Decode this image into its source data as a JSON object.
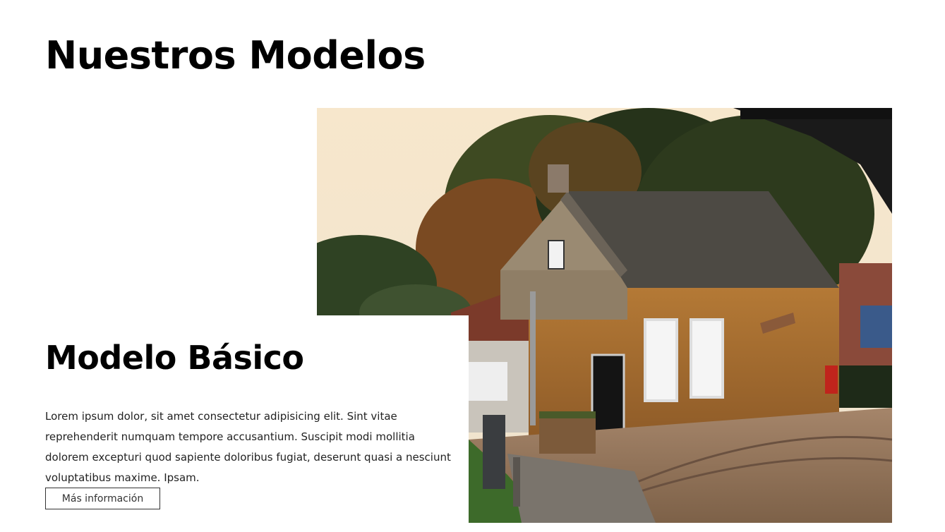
{
  "section": {
    "title": "Nuestros Modelos"
  },
  "model": {
    "name": "Modelo Básico",
    "description": "Lorem ipsum dolor, sit amet consectetur adipisicing elit. Sint vitae reprehenderit numquam tempore accusantium. Suscipit modi mollitia dolorem excepturi quod sapiente doloribus fugiat, deserunt quasi a nesciunt voluptatibus maxime. Ipsam.",
    "button_label": "Más información",
    "image": "brick-house-photo"
  },
  "colors": {
    "background": "#ffffff",
    "text": "#000000",
    "button_border": "#333333"
  }
}
